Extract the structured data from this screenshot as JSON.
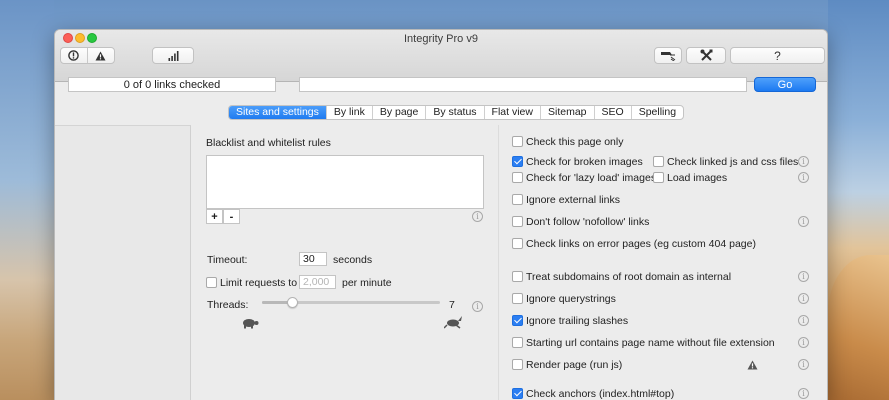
{
  "window": {
    "title": "Integrity Pro v9"
  },
  "toolbar": {
    "info_icon": "info-circle-icon",
    "warning_icon": "warning-triangle-icon",
    "signal_icon": "bar-chart-icon",
    "broom_icon": "broom-icon",
    "tools_icon": "tools-icon",
    "help_label": "?"
  },
  "status": {
    "links_checked": "0 of 0 links checked"
  },
  "url": {
    "value": "",
    "go_label": "Go"
  },
  "tabs": [
    {
      "label": "Sites and settings",
      "active": true
    },
    {
      "label": "By link"
    },
    {
      "label": "By page"
    },
    {
      "label": "By status"
    },
    {
      "label": "Flat view"
    },
    {
      "label": "Sitemap"
    },
    {
      "label": "SEO"
    },
    {
      "label": "Spelling"
    }
  ],
  "settings": {
    "rules_title": "Blacklist and whitelist rules",
    "add_label": "+",
    "remove_label": "-",
    "timeout_label": "Timeout:",
    "timeout_value": "30",
    "timeout_unit": "seconds",
    "limit_label": "Limit requests to",
    "limit_value": "2,000",
    "limit_unit": "per minute",
    "limit_checked": false,
    "threads_label": "Threads:",
    "threads_value": "7",
    "threads_min": 1,
    "threads_max": 40
  },
  "options": {
    "check_this_page_only": {
      "label": "Check this page only",
      "checked": false
    },
    "check_broken_images": {
      "label": "Check for broken images",
      "checked": true
    },
    "check_linked_js_css": {
      "label": "Check linked js and css files",
      "checked": false
    },
    "check_lazy_load": {
      "label": "Check for 'lazy load' images",
      "checked": false
    },
    "load_images": {
      "label": "Load images",
      "checked": false
    },
    "ignore_external": {
      "label": "Ignore external links",
      "checked": false
    },
    "dont_follow_nofollow": {
      "label": "Don't follow 'nofollow' links",
      "checked": false
    },
    "check_error_pages": {
      "label": "Check links on error pages (eg custom 404 page)",
      "checked": false
    },
    "treat_subdomains": {
      "label": "Treat subdomains of root domain as internal",
      "checked": false
    },
    "ignore_querystrings": {
      "label": "Ignore querystrings",
      "checked": false
    },
    "ignore_trailing_slashes": {
      "label": "Ignore trailing slashes",
      "checked": true
    },
    "starting_url_page_name": {
      "label": "Starting url contains page name without file extension",
      "checked": false
    },
    "render_page": {
      "label": "Render page (run js)",
      "checked": false
    },
    "check_anchors": {
      "label": "Check anchors (index.html#top)",
      "checked": true
    }
  },
  "colors": {
    "accent": "#1f7bf0",
    "window_bg": "#ececec"
  }
}
